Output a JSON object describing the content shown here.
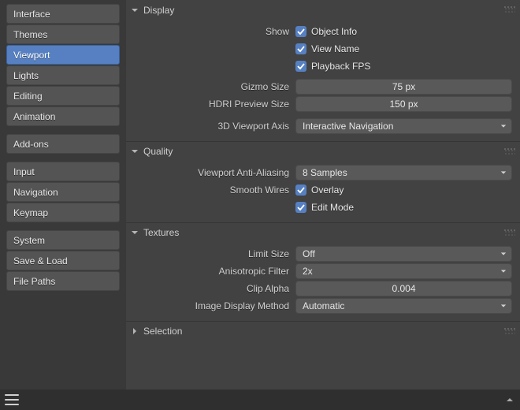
{
  "sidebar": {
    "groups": [
      {
        "items": [
          {
            "label": "Interface"
          },
          {
            "label": "Themes"
          },
          {
            "label": "Viewport",
            "active": true
          },
          {
            "label": "Lights"
          },
          {
            "label": "Editing"
          },
          {
            "label": "Animation"
          }
        ]
      },
      {
        "items": [
          {
            "label": "Add-ons"
          }
        ]
      },
      {
        "items": [
          {
            "label": "Input"
          },
          {
            "label": "Navigation"
          },
          {
            "label": "Keymap"
          }
        ]
      },
      {
        "items": [
          {
            "label": "System"
          },
          {
            "label": "Save & Load"
          },
          {
            "label": "File Paths"
          }
        ]
      }
    ]
  },
  "panels": {
    "display": {
      "title": "Display",
      "show_label": "Show",
      "object_info": "Object Info",
      "view_name": "View Name",
      "playback_fps": "Playback FPS",
      "gizmo_size_label": "Gizmo Size",
      "gizmo_size_value": "75 px",
      "hdri_label": "HDRI Preview Size",
      "hdri_value": "150 px",
      "axis_label": "3D Viewport Axis",
      "axis_value": "Interactive Navigation"
    },
    "quality": {
      "title": "Quality",
      "aa_label": "Viewport Anti-Aliasing",
      "aa_value": "8 Samples",
      "smooth_wires_label": "Smooth Wires",
      "overlay": "Overlay",
      "edit_mode": "Edit Mode"
    },
    "textures": {
      "title": "Textures",
      "limit_size_label": "Limit Size",
      "limit_size_value": "Off",
      "aniso_label": "Anisotropic Filter",
      "aniso_value": "2x",
      "clip_alpha_label": "Clip Alpha",
      "clip_alpha_value": "0.004",
      "idm_label": "Image Display Method",
      "idm_value": "Automatic"
    },
    "selection": {
      "title": "Selection"
    }
  }
}
